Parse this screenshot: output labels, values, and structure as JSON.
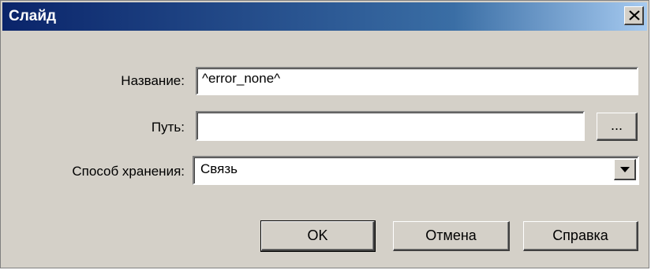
{
  "window": {
    "title": "Слайд"
  },
  "form": {
    "name_label": "Название:",
    "name_value": "^error_none^",
    "path_label": "Путь:",
    "path_value": "",
    "browse_label": "...",
    "storage_label": "Способ хранения:",
    "storage_value": "Связь"
  },
  "buttons": {
    "ok": "OK",
    "cancel": "Отмена",
    "help": "Справка"
  },
  "colors": {
    "titlebar_start": "#0a246a",
    "titlebar_end": "#a6caf0",
    "dialog_bg": "#d4d0c8"
  }
}
